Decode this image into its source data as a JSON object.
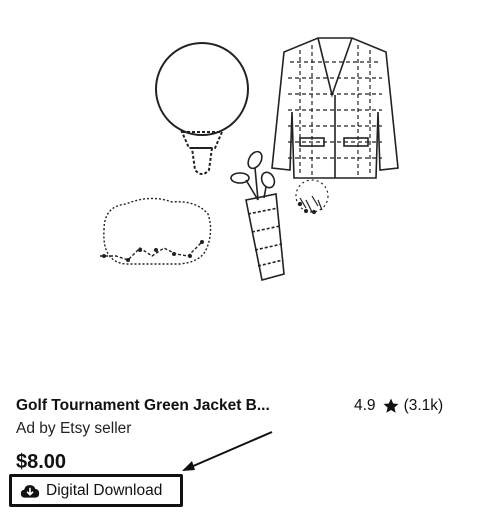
{
  "listing": {
    "title": "Golf Tournament Green Jacket B...",
    "rating": "4.9",
    "review_count": "(3.1k)",
    "ad_label": "Ad by Etsy seller",
    "price": "$8.00",
    "badge_label": "Digital Download",
    "icons": {
      "star": "star-icon",
      "badge": "cloud-download-icon"
    }
  }
}
